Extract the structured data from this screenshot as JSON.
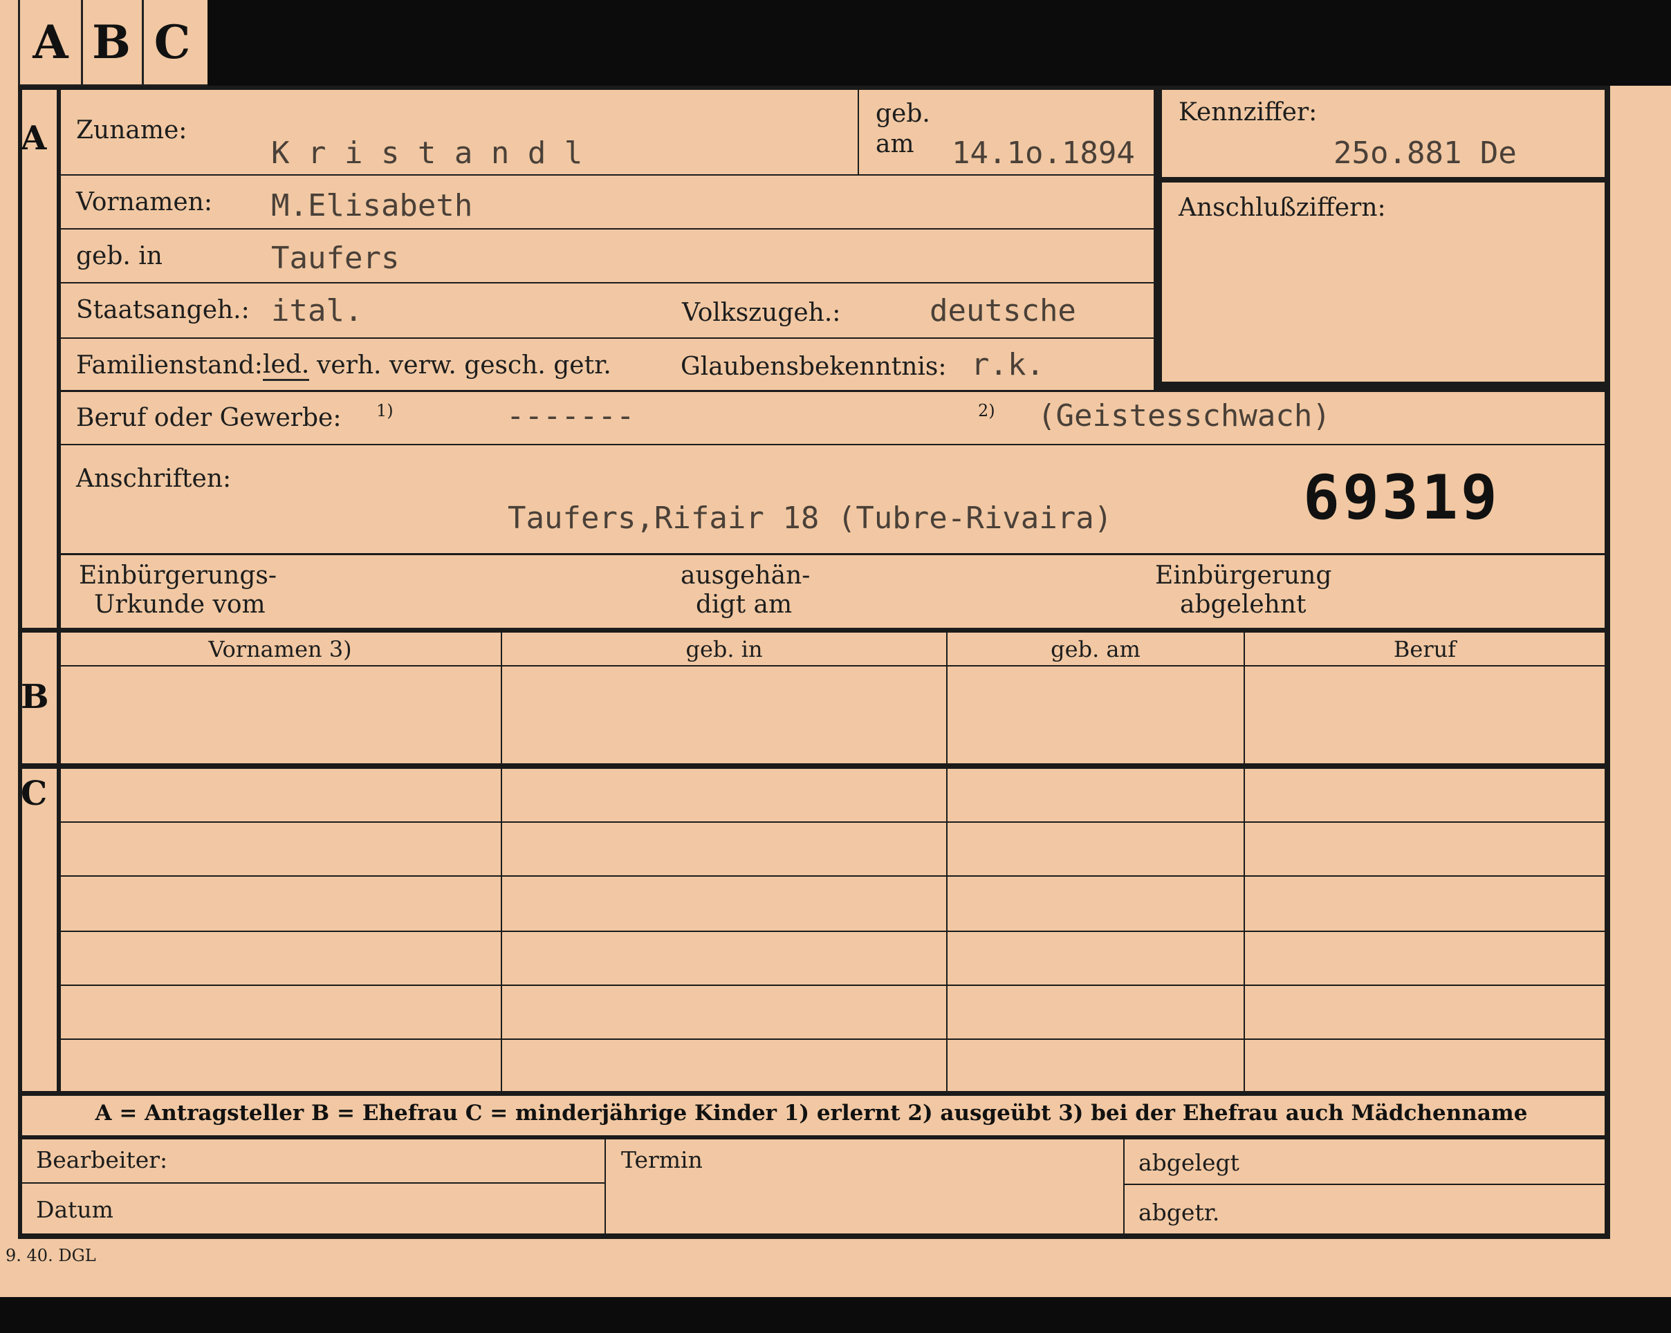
{
  "tabs": [
    "A",
    "B",
    "C"
  ],
  "section_letters": {
    "a": "A",
    "b": "B",
    "c": "C"
  },
  "fields": {
    "zuname_label": "Zuname:",
    "zuname_value": "K r i s t a n d l",
    "geb_label_line1": "geb.",
    "geb_label_line2": "am",
    "geb_am_value": "14.1o.1894",
    "kennziffer_label": "Kennziffer:",
    "kennziffer_value": "25o.881  De",
    "anschluss_label": "Anschlußziffern:",
    "vornamen_label": "Vornamen:",
    "vornamen_value": "M.Elisabeth",
    "geb_in_label": "geb. in",
    "geb_in_value": "Taufers",
    "staat_label": "Staatsangeh.:",
    "staat_value": "ital.",
    "volks_label": "Volkszugeh.:",
    "volks_value": "deutsche",
    "familienstand_label": "Familienstand:",
    "familienstand_selected": "led.",
    "familienstand_options": "verh. verw. gesch. getr.",
    "glauben_label": "Glaubensbekenntnis:",
    "glauben_value": "r.k.",
    "beruf_label": "Beruf oder Gewerbe:",
    "beruf_note1": "1)",
    "beruf_value1": "-------",
    "beruf_note2": "2)",
    "beruf_value2": "(Geistesschwach)",
    "anschriften_label": "Anschriften:",
    "anschriften_value": "Taufers,Rifair 18 (Tubre-Rivaira)",
    "stamp_number": "69319",
    "einb_urkunde_line1": "Einbürgerungs-",
    "einb_urkunde_line2": "Urkunde vom",
    "ausgehaendigt_line1": "ausgehän-",
    "ausgehaendigt_line2": "digt am",
    "einb_abgelehnt_line1": "Einbürgerung",
    "einb_abgelehnt_line2": "abgelehnt"
  },
  "table_headers": [
    "Vornamen 3)",
    "geb. in",
    "geb. am",
    "Beruf"
  ],
  "legend": "A = Antragsteller   B = Ehefrau   C = minderjährige Kinder   1) erlernt   2) ausgeübt   3) bei der Ehefrau auch Mädchenname",
  "footer": {
    "bearbeiter": "Bearbeiter:",
    "datum": "Datum",
    "termin": "Termin",
    "abgelegt": "abgelegt",
    "abgetr": "abgetr."
  },
  "print_code": "9. 40. DGL"
}
